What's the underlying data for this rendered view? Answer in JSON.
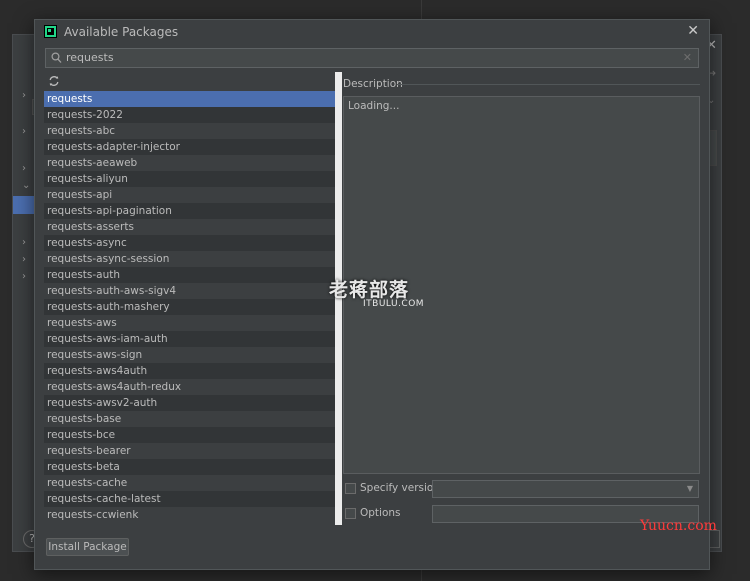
{
  "dialog": {
    "title": "Available Packages"
  },
  "search": {
    "value": "requests",
    "placeholder": ""
  },
  "packages": [
    "requests",
    "requests-2022",
    "requests-abc",
    "requests-adapter-injector",
    "requests-aeaweb",
    "requests-aliyun",
    "requests-api",
    "requests-api-pagination",
    "requests-asserts",
    "requests-async",
    "requests-async-session",
    "requests-auth",
    "requests-auth-aws-sigv4",
    "requests-auth-mashery",
    "requests-aws",
    "requests-aws-iam-auth",
    "requests-aws-sign",
    "requests-aws4auth",
    "requests-aws4auth-redux",
    "requests-awsv2-auth",
    "requests-base",
    "requests-bce",
    "requests-bearer",
    "requests-beta",
    "requests-cache",
    "requests-cache-latest",
    "requests-ccwienk"
  ],
  "selected_package": "requests",
  "description": {
    "label": "Description",
    "text": "Loading..."
  },
  "options": {
    "specify_version_label": "Specify version",
    "options_label": "Options"
  },
  "buttons": {
    "install": "Install Package"
  },
  "watermark": {
    "cn": "老蒋部落",
    "en": "ITBULU.COM",
    "site": "Yuucn.com"
  },
  "colors": {
    "selection": "#4b6eaf",
    "background": "#3c3f41"
  }
}
